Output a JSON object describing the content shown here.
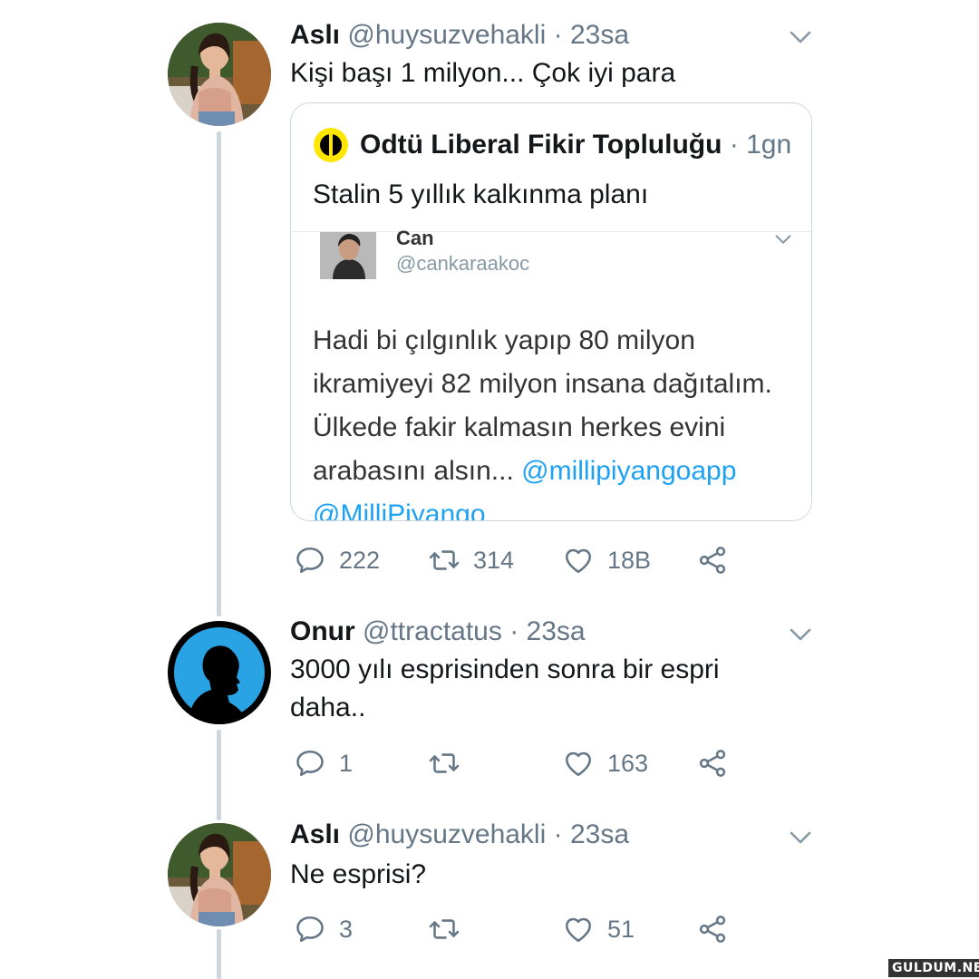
{
  "colors": {
    "text": "#14171a",
    "muted": "#657786",
    "link": "#1da1f2",
    "thread_line": "#ccd6dd",
    "border": "#ccd6dd",
    "logo_yellow": "#ffe600"
  },
  "tweets": [
    {
      "author": "Aslı",
      "handle": "@huysuzvehakli",
      "separator": "·",
      "time": "23sa",
      "text": "Kişi başı 1 milyon... Çok iyi para",
      "quote": {
        "author": "Odtü Liberal Fikir Topluluğu",
        "separator": "·",
        "time": "1gn",
        "text": "Stalin 5 yıllık kalkınma planı",
        "embedded": {
          "author": "Can",
          "handle": "@cankaraakoc",
          "body_lines": [
            "Hadi bi çılgınlık yapıp 80 milyon",
            "ikramiyeyi 82 milyon insana dağıtalım.",
            "Ülkede fakir kalmasın herkes evini",
            "arabasını alsın..."
          ],
          "mention_1": "@millipiyangoapp",
          "mention_2": "@MilliPiyango"
        }
      },
      "stats": {
        "replies": "222",
        "retweets": "314",
        "likes": "18B"
      }
    },
    {
      "author": "Onur",
      "handle": "@ttractatus",
      "separator": "·",
      "time": "23sa",
      "text_line_1": "3000 yılı esprisinden sonra bir espri",
      "text_line_2": "daha..",
      "stats": {
        "replies": "1",
        "retweets": "",
        "likes": "163"
      }
    },
    {
      "author": "Aslı",
      "handle": "@huysuzvehakli",
      "separator": "·",
      "time": "23sa",
      "text": "Ne esprisi?",
      "stats": {
        "replies": "3",
        "retweets": "",
        "likes": "51"
      }
    }
  ],
  "icons": {
    "reply": "reply-icon",
    "retweet": "retweet-icon",
    "like": "heart-icon",
    "share": "share-icon",
    "more": "chevron-down-icon"
  },
  "watermark": "GULDUM.NET"
}
